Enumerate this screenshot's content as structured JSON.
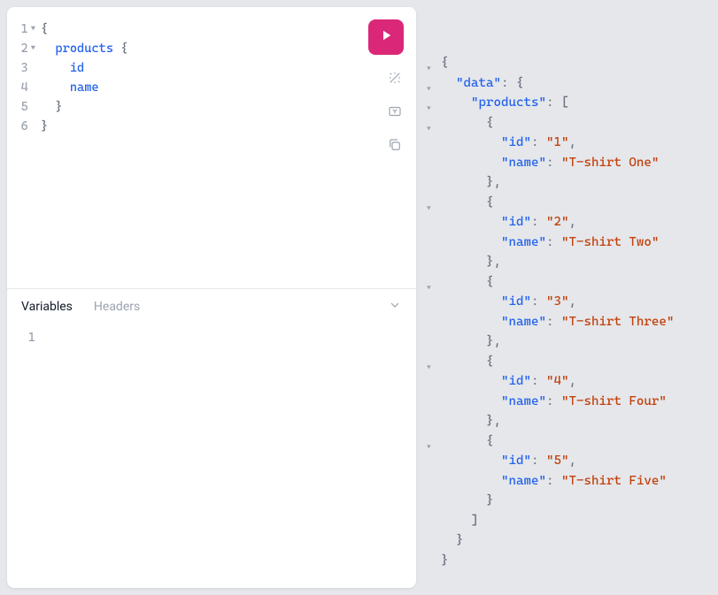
{
  "query_editor": {
    "lines": [
      {
        "num": "1",
        "fold": true,
        "indent": 0,
        "tokens": [
          {
            "t": "{",
            "c": "brace"
          }
        ]
      },
      {
        "num": "2",
        "fold": true,
        "indent": 1,
        "tokens": [
          {
            "t": "products",
            "c": "field"
          },
          {
            "t": " ",
            "c": "sp"
          },
          {
            "t": "{",
            "c": "brace"
          }
        ]
      },
      {
        "num": "3",
        "fold": false,
        "indent": 2,
        "tokens": [
          {
            "t": "id",
            "c": "field"
          }
        ]
      },
      {
        "num": "4",
        "fold": false,
        "indent": 2,
        "tokens": [
          {
            "t": "name",
            "c": "field"
          }
        ]
      },
      {
        "num": "5",
        "fold": false,
        "indent": 1,
        "tokens": [
          {
            "t": "}",
            "c": "brace"
          }
        ]
      },
      {
        "num": "6",
        "fold": false,
        "indent": 0,
        "tokens": [
          {
            "t": "}",
            "c": "brace"
          }
        ]
      }
    ]
  },
  "tabs": {
    "variables": "Variables",
    "headers": "Headers",
    "active": "variables"
  },
  "vars_editor": {
    "line_num": "1"
  },
  "response": {
    "data_key": "data",
    "products_key": "products",
    "id_key": "id",
    "name_key": "name",
    "items": [
      {
        "id": "1",
        "name": "T-shirt One"
      },
      {
        "id": "2",
        "name": "T-shirt Two"
      },
      {
        "id": "3",
        "name": "T-shirt Three"
      },
      {
        "id": "4",
        "name": "T-shirt Four"
      },
      {
        "id": "5",
        "name": "T-shirt Five"
      }
    ]
  },
  "colors": {
    "accent": "#db2777",
    "key": "#2563eb",
    "string": "#c2410c"
  }
}
